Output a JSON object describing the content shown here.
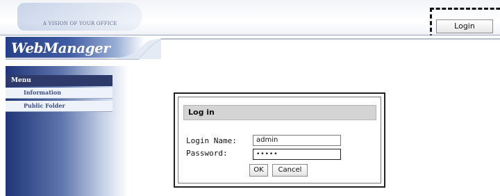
{
  "banner": {
    "tagline": "A VISION OF YOUR OFFICE",
    "login_button": "Login"
  },
  "header": {
    "app_name": "WebManager"
  },
  "sidebar": {
    "menu_title": "Menu",
    "items": [
      {
        "label": "Information"
      },
      {
        "label": "Public Folder"
      }
    ]
  },
  "dialog": {
    "title": "Log in",
    "login_name_label": "Login Name:",
    "login_name_value": "admin",
    "password_label": "Password:",
    "password_value": "•••••",
    "ok_label": "OK",
    "cancel_label": "Cancel"
  },
  "colors": {
    "menu_title_bg": "#2e3a6a",
    "sidebar_dark": "#1f3577",
    "callout_border": "#111111"
  }
}
